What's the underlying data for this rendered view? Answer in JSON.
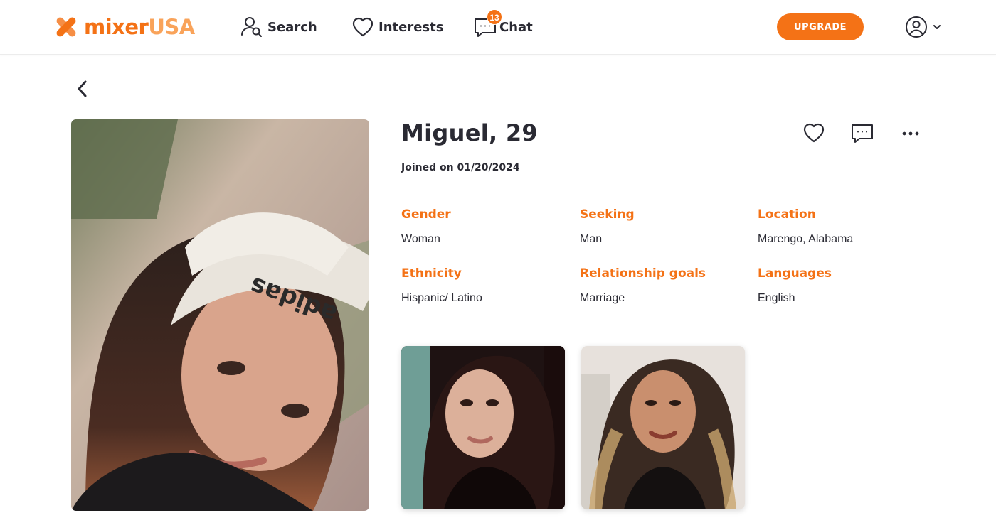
{
  "header": {
    "logo": {
      "mixer": "mixer",
      "usa": "USA"
    },
    "nav": {
      "search_label": "Search",
      "interests_label": "Interests",
      "chat_label": "Chat",
      "chat_badge": "13"
    },
    "upgrade_label": "UPGRADE"
  },
  "profile": {
    "name": "Miguel, 29",
    "joined": "Joined on 01/20/2024",
    "fields": [
      {
        "label": "Gender",
        "value": "Woman"
      },
      {
        "label": "Seeking",
        "value": "Man"
      },
      {
        "label": "Location",
        "value": "Marengo, Alabama"
      },
      {
        "label": "Ethnicity",
        "value": "Hispanic/ Latino"
      },
      {
        "label": "Relationship goals",
        "value": "Marriage"
      },
      {
        "label": "Languages",
        "value": "English"
      }
    ]
  },
  "icons": {
    "logo": "x-logo-icon",
    "search": "user-search-icon",
    "interests": "heart-icon",
    "chat": "chat-bubble-icon",
    "account": "user-circle-icon",
    "account_menu": "chevron-down-icon",
    "back": "chevron-left-icon",
    "like": "heart-outline-icon",
    "message": "chat-bubble-icon",
    "more": "more-horizontal-icon"
  },
  "colors": {
    "accent": "#f47216",
    "accent_light": "#f9a35a",
    "text": "#2a2a33"
  }
}
